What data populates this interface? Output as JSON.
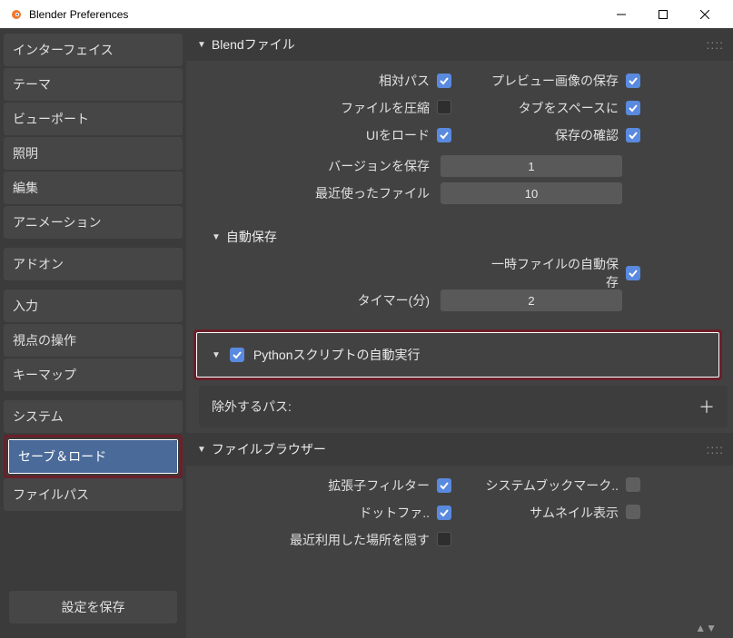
{
  "window": {
    "title": "Blender Preferences"
  },
  "sidebar": {
    "groups": [
      {
        "items": [
          {
            "label": "インターフェイス",
            "name": "nav-interface"
          },
          {
            "label": "テーマ",
            "name": "nav-theme"
          },
          {
            "label": "ビューポート",
            "name": "nav-viewport"
          },
          {
            "label": "照明",
            "name": "nav-lighting"
          },
          {
            "label": "編集",
            "name": "nav-editing"
          },
          {
            "label": "アニメーション",
            "name": "nav-animation"
          }
        ]
      },
      {
        "items": [
          {
            "label": "アドオン",
            "name": "nav-addons"
          }
        ]
      },
      {
        "items": [
          {
            "label": "入力",
            "name": "nav-input"
          },
          {
            "label": "視点の操作",
            "name": "nav-navigation"
          },
          {
            "label": "キーマップ",
            "name": "nav-keymap"
          }
        ]
      },
      {
        "items": [
          {
            "label": "システム",
            "name": "nav-system"
          },
          {
            "label": "セーブ＆ロード",
            "name": "nav-save-load",
            "active": true,
            "highlight": true
          },
          {
            "label": "ファイルパス",
            "name": "nav-filepaths"
          }
        ]
      }
    ],
    "save_button": "設定を保存"
  },
  "sections": {
    "blend_file": {
      "title": "Blendファイル",
      "relative_paths": "相対パス",
      "compress": "ファイルを圧縮",
      "load_ui": "UIをロード",
      "preview": "プレビュー画像の保存",
      "tabs_spaces": "タブをスペースに",
      "save_prompt": "保存の確認",
      "versions": "バージョンを保存",
      "versions_val": "1",
      "recent": "最近使ったファイル",
      "recent_val": "10"
    },
    "autosave": {
      "title": "自動保存",
      "temp": "一時ファイルの自動保存",
      "timer": "タイマー(分)",
      "timer_val": "2"
    },
    "python": {
      "label": "Pythonスクリプトの自動実行",
      "exclude": "除外するパス:"
    },
    "filebrowser": {
      "title": "ファイルブラウザー",
      "ext_filter": "拡張子フィルター",
      "dotfiles": "ドットファ..",
      "hide_recent": "最近利用した場所を隠す",
      "bookmarks": "システムブックマーク..",
      "thumbnails": "サムネイル表示"
    }
  }
}
